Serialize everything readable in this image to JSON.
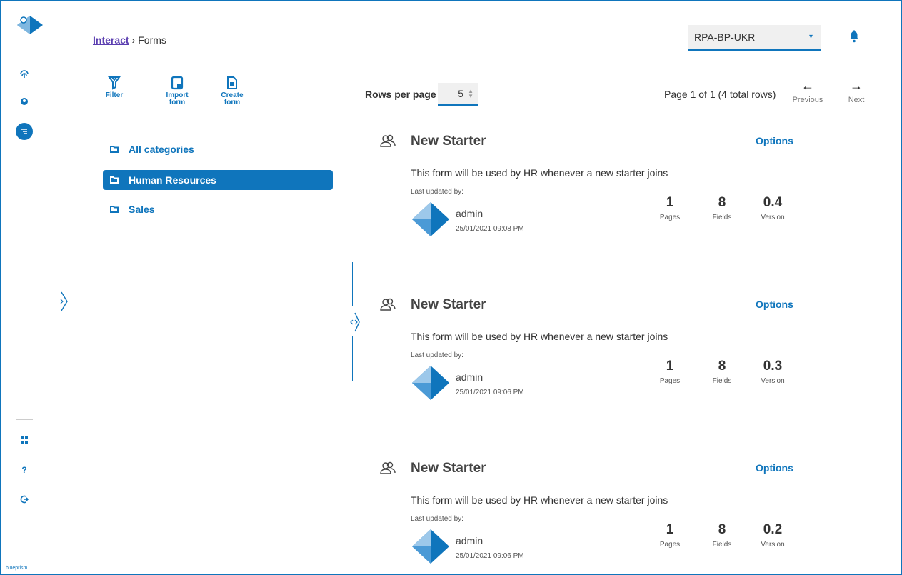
{
  "app": {
    "brand": "blueprism"
  },
  "breadcrumb": {
    "root": "Interact",
    "separator": "›",
    "current": "Forms"
  },
  "environment": {
    "selected": "RPA-BP-UKR"
  },
  "toolbar": {
    "filter_label": "Filter",
    "import_label": "Import form",
    "create_label": "Create form"
  },
  "categories": [
    {
      "label": "All categories",
      "selected": false
    },
    {
      "label": "Human Resources",
      "selected": true
    },
    {
      "label": "Sales",
      "selected": false
    }
  ],
  "pagination": {
    "rows_label": "Rows per page",
    "rows_value": "5",
    "info": "Page 1 of 1 (4 total rows)",
    "previous_label": "Previous",
    "next_label": "Next"
  },
  "forms": [
    {
      "title": "New Starter",
      "options_label": "Options",
      "description": "This form will be used by HR whenever a new starter joins",
      "last_updated_label": "Last updated by:",
      "user": "admin",
      "date": "25/01/2021 09:08 PM",
      "pages": "1",
      "pages_label": "Pages",
      "fields": "8",
      "fields_label": "Fields",
      "version": "0.4",
      "version_label": "Version"
    },
    {
      "title": "New Starter",
      "options_label": "Options",
      "description": "This form will be used by HR whenever a new starter joins",
      "last_updated_label": "Last updated by:",
      "user": "admin",
      "date": "25/01/2021 09:06 PM",
      "pages": "1",
      "pages_label": "Pages",
      "fields": "8",
      "fields_label": "Fields",
      "version": "0.3",
      "version_label": "Version"
    },
    {
      "title": "New Starter",
      "options_label": "Options",
      "description": "This form will be used by HR whenever a new starter joins",
      "last_updated_label": "Last updated by:",
      "user": "admin",
      "date": "25/01/2021 09:06 PM",
      "pages": "1",
      "pages_label": "Pages",
      "fields": "8",
      "fields_label": "Fields",
      "version": "0.2",
      "version_label": "Version"
    }
  ],
  "colors": {
    "accent": "#0f75bc",
    "link": "#5b3eb0"
  }
}
